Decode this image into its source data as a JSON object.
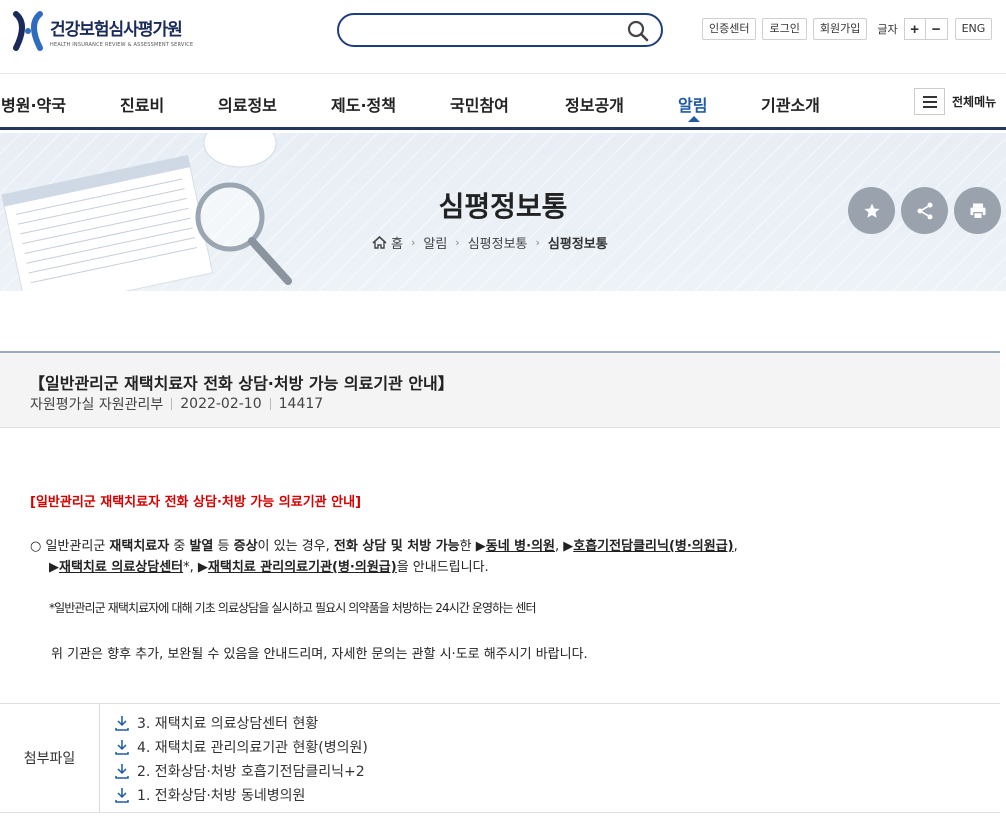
{
  "header": {
    "logo_title": "건강보험심사평가원",
    "logo_subtitle": "HEALTH INSURANCE REVIEW & ASSESSMENT SERVICE",
    "search_placeholder": "",
    "util": {
      "cert_center": "인증센터",
      "login": "로그인",
      "signup": "회원가입",
      "font_label": "글자",
      "font_plus": "+",
      "font_minus": "−",
      "eng": "ENG"
    }
  },
  "gnb": {
    "items": [
      "병원·약국",
      "진료비",
      "의료정보",
      "제도·정책",
      "국민참여",
      "정보공개",
      "알림",
      "기관소개"
    ],
    "active_index": 6,
    "all_menu": "전체메뉴"
  },
  "banner": {
    "title": "심평정보통",
    "breadcrumb": [
      "홈",
      "알림",
      "심평정보통",
      "심평정보통"
    ]
  },
  "article": {
    "title": "【일반관리군 재택치료자 전화 상담·처방 가능 의료기관 안내】",
    "department": "자원평가실 자원관리부",
    "date": "2022-02-10",
    "views": "14417",
    "red_heading": "[일반관리군 재택치료자 전화 상담·처방 가능 의료기관 안내]",
    "line1": {
      "p1": "○ 일반관리군 ",
      "p2": "재택치료자",
      "p3": " 중 ",
      "p4": "발열",
      "p5": " 등 ",
      "p6": "증상",
      "p7": "이 있는 경우, ",
      "p8": "전화 상담 및 처방 가능",
      "p9": "한 ▶",
      "link1": "동네 병·의원",
      "p10": ", ▶",
      "link2": "호흡기전담클리닉(병·의원급)",
      "p11": ","
    },
    "line2": {
      "p1": "▶",
      "link1": "재택치료 의료상담센터",
      "p2": "*, ▶",
      "link2": "재택치료 관리의료기관(병·의원급)",
      "p3": "을 안내드립니다."
    },
    "footnote": "*일반관리군 재택치료자에 대해 기초 의료상담을 실시하고 필요시 의약품을 처방하는 24시간 운영하는 센터",
    "notice": "위 기관은 향후 추가, 보완될 수 있음을 안내드리며, 자세한 문의는 관할 시·도로 해주시기 바랍니다."
  },
  "attachments": {
    "label": "첨부파일",
    "files": [
      "3. 재택치료 의료상담센터 현황",
      "4. 재택치료 관리의료기관 현황(병의원)",
      "2. 전화상담·처방 호흡기전담클리닉+2",
      "1. 전화상담·처방 동네병의원"
    ]
  },
  "colors": {
    "brand_navy": "#1f3f7a",
    "active_menu": "#1f5aa6",
    "red_heading": "#d60000"
  }
}
